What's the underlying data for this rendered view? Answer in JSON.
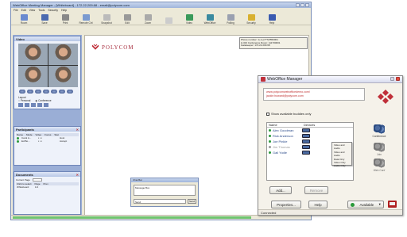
{
  "main_window": {
    "title": "WebOffice Meeting Manager - [Whiteboard] - 172.22.209.68 - email@polycom.com",
    "menu": [
      "File",
      "Edit",
      "View",
      "Tools",
      "Security",
      "Help"
    ],
    "toolbar": [
      {
        "label": "Room",
        "icon": "room-icon",
        "color": "#6a8ad0"
      },
      {
        "label": "Save",
        "icon": "save-icon",
        "color": "#4a6ab0"
      },
      {
        "label": "Print",
        "icon": "print-icon",
        "color": "#888888"
      },
      {
        "label": "Remote Ctrl",
        "icon": "remote-icon",
        "color": "#7a9ad0"
      },
      {
        "label": "Snapshot",
        "icon": "snapshot-icon",
        "color": "#bbbbbb"
      },
      {
        "label": "Edit",
        "icon": "edit-icon",
        "color": "#999999"
      },
      {
        "label": "Zoom",
        "icon": "zoom-icon",
        "color": "#aaaaaa"
      },
      {
        "label": "",
        "icon": "separator-icon",
        "color": "#cccccc"
      },
      {
        "label": "Video",
        "icon": "video-icon",
        "color": "#3a9a5a"
      },
      {
        "label": "WebOffice",
        "icon": "weboffice-icon",
        "color": "#3a8aa0"
      },
      {
        "label": "Polling",
        "icon": "polling-icon",
        "color": "#9aa0b0"
      },
      {
        "label": "Security",
        "icon": "security-icon",
        "color": "#d8b030"
      },
      {
        "label": "Help",
        "icon": "help-icon",
        "color": "#3a5ab0"
      }
    ],
    "video_panel": {
      "title": "Video",
      "layout_label": "Layout",
      "personal": "Personal",
      "conference": "Conference"
    },
    "participants_panel": {
      "title": "Participants",
      "columns": [
        "Name",
        "Mode",
        "Video",
        "Focus",
        "Stat"
      ],
      "rows": [
        {
          "name": "Carol A...",
          "mode": "",
          "stat": "Host"
        },
        {
          "name": "Ed Bo...",
          "mode": "",
          "stat": "Accept"
        }
      ]
    },
    "documents_panel": {
      "title": "Documents",
      "current_page_label": "Current Page",
      "columns": [
        "Click to select",
        "Page",
        "Prev"
      ],
      "rows": [
        {
          "name": "Whiteboard",
          "page": "1/1",
          "prev": ""
        }
      ]
    },
    "logo_text": "POLYCOM",
    "info_box": [
      "Phone number: 1+1+(777)5550001",
      "H.323 Conference Room: 111700001",
      "Gatekeeper: 172.22.209.68"
    ],
    "chat": {
      "title": "Chat Bar",
      "top_text": "Message Box",
      "input_label": "Send",
      "send_button": "Send"
    }
  },
  "manager": {
    "title": "WebOffice Manager",
    "emails": [
      "www.polycomwebofficedemo.com/",
      "jackie.howard@polycom.com"
    ],
    "show_available": "Show available buddies only",
    "columns": [
      "Name",
      "Devices"
    ],
    "buddies": [
      {
        "name": "Alex Goodman",
        "status_color": "#2a9a3a"
      },
      {
        "name": "Rick Anderson",
        "status_color": "#2a9a3a"
      },
      {
        "name": "Joe Pinkle",
        "status_color": "#2a9a3a"
      },
      {
        "name": "Jim Thomas",
        "status_color": "#999999"
      },
      {
        "name": "Gail Yodle",
        "status_color": "#2a9a3a"
      }
    ],
    "context_menu": [
      "Video and Audio",
      "Video and Audio",
      "Data Only",
      "Video Only",
      "Audio Only"
    ],
    "side_buttons": [
      "Conference",
      "Join",
      "Web Conf"
    ],
    "add_button": "Add...",
    "remove_button": "Remove",
    "properties_button": "Properties...",
    "help_button": "Help",
    "available_button": "Available",
    "status_text": "Connected"
  },
  "colors": {
    "polycom_red": "#c0303a",
    "link_blue": "#2a4a8a",
    "panel_blue": "#9aaed6"
  }
}
